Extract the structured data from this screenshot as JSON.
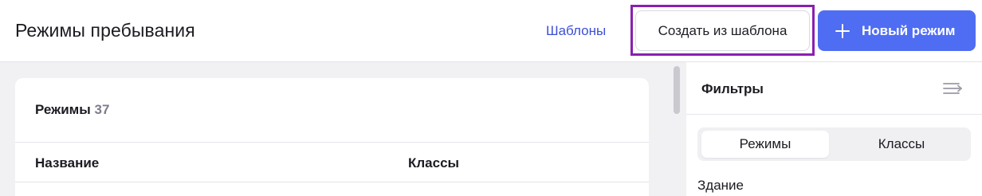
{
  "header": {
    "title": "Режимы пребывания",
    "templates_link": "Шаблоны",
    "create_from_template_label": "Создать из шаблона",
    "new_mode_label": "Новый режим",
    "new_mode_icon": "plus-icon"
  },
  "modes_card": {
    "title": "Режимы",
    "count": "37",
    "columns": [
      "Название",
      "Классы"
    ]
  },
  "filters": {
    "title": "Фильтры",
    "collapse_icon": "collapse-right-icon",
    "tabs": [
      {
        "label": "Режимы",
        "active": true
      },
      {
        "label": "Классы",
        "active": false
      }
    ],
    "building_label": "Здание"
  },
  "colors": {
    "accent": "#4f6df2",
    "link": "#3d4fd6",
    "highlight_outline": "#8a1fb0",
    "background": "#f1f1f4"
  }
}
